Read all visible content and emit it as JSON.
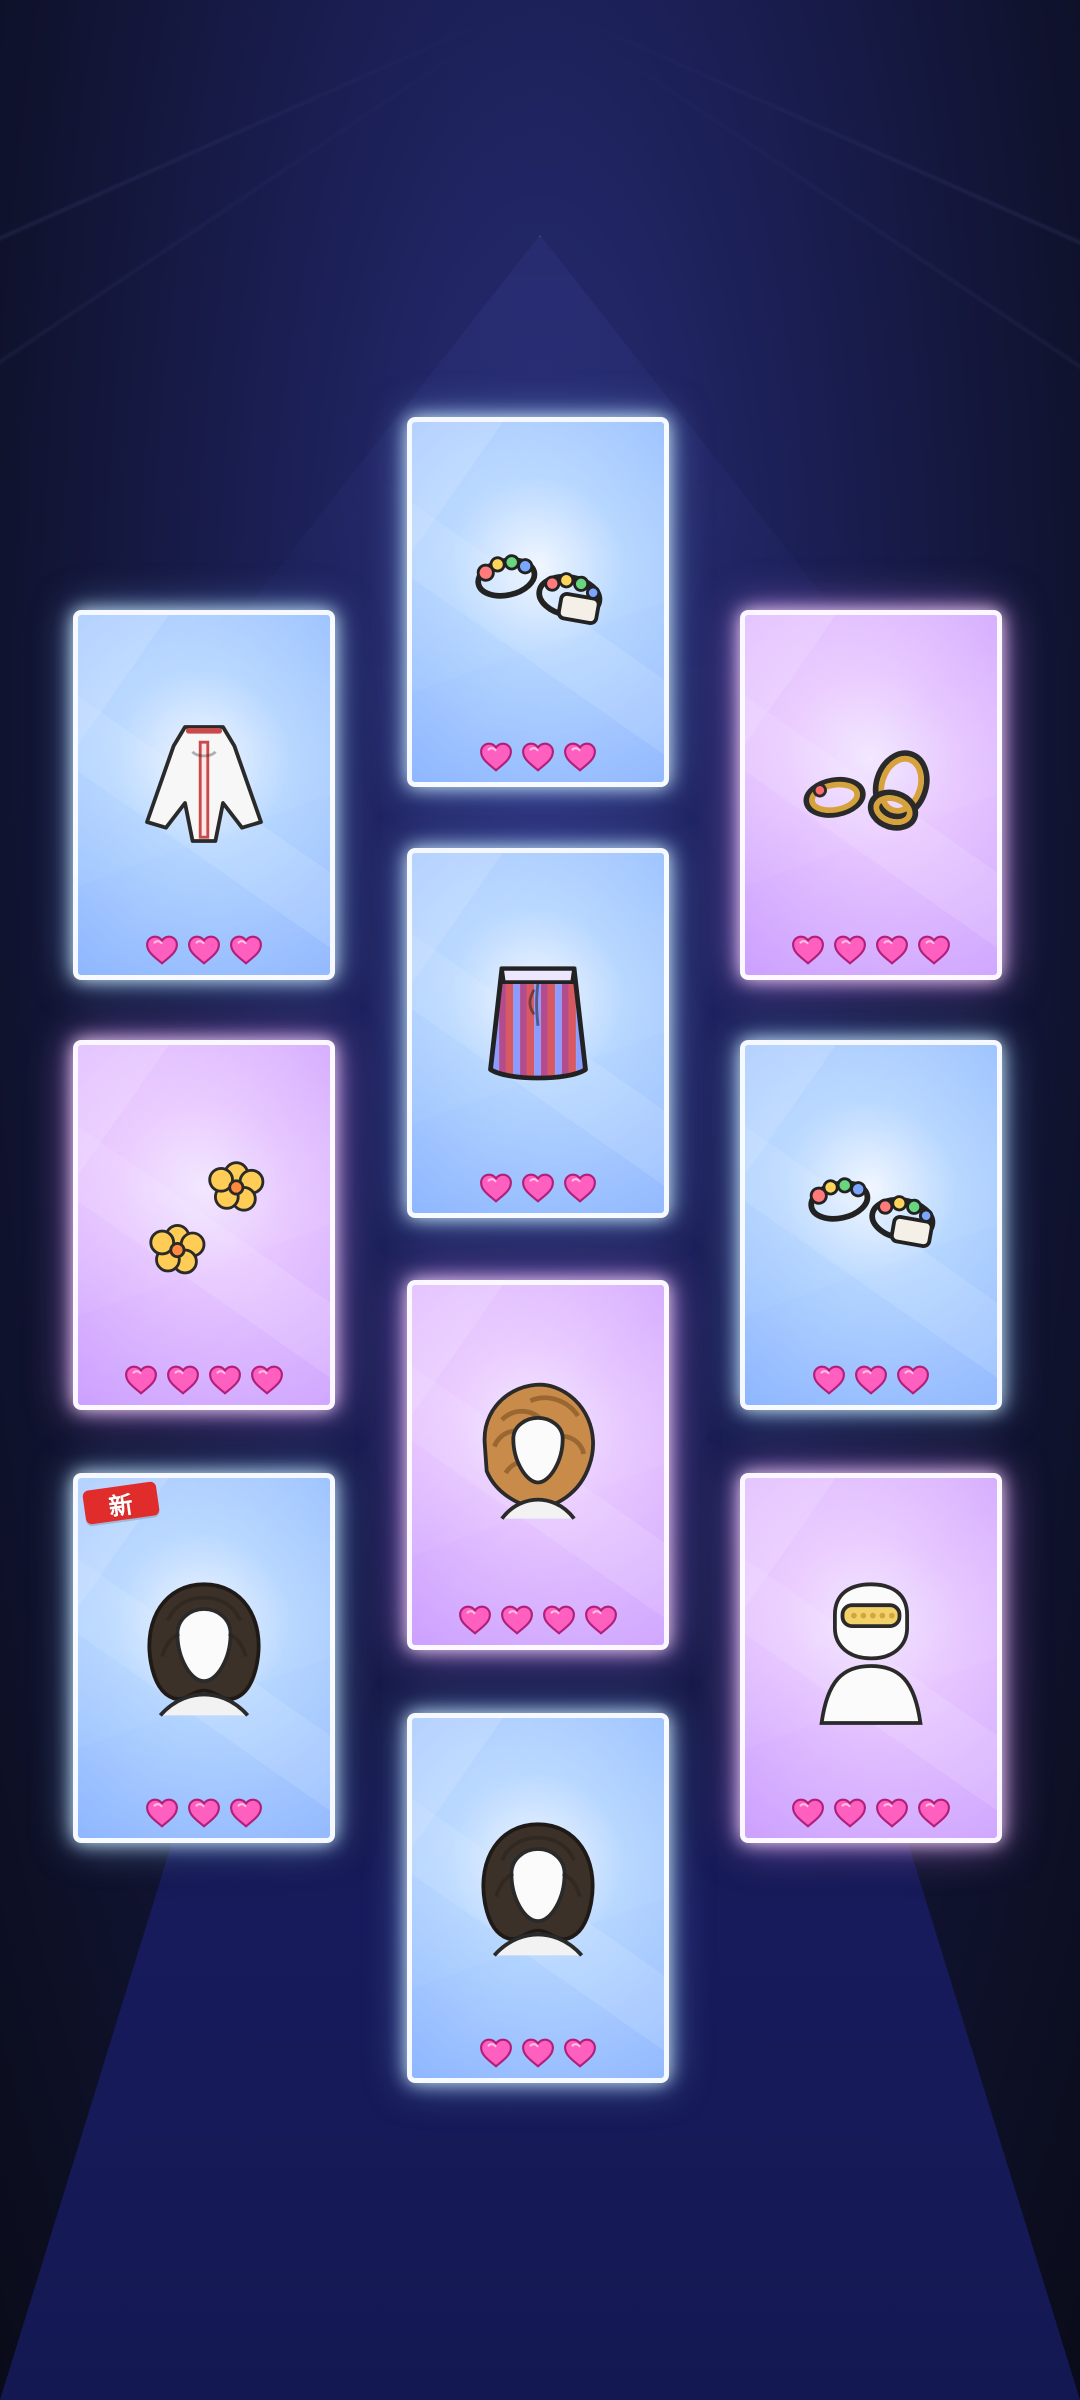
{
  "screen": {
    "type": "gacha-results"
  },
  "cards": [
    {
      "id": "top-center",
      "variant": "blue",
      "item": "bracelets",
      "hearts": 3,
      "is_new": false
    },
    {
      "id": "left-1",
      "variant": "blue",
      "item": "cape",
      "hearts": 3,
      "is_new": false
    },
    {
      "id": "right-1",
      "variant": "purple",
      "item": "gold-bangles",
      "hearts": 4,
      "is_new": false
    },
    {
      "id": "center-2",
      "variant": "blue",
      "item": "striped-skirt",
      "hearts": 3,
      "is_new": false
    },
    {
      "id": "left-2",
      "variant": "purple",
      "item": "flower-earrings",
      "hearts": 4,
      "is_new": false
    },
    {
      "id": "right-2",
      "variant": "blue",
      "item": "bracelets",
      "hearts": 3,
      "is_new": false
    },
    {
      "id": "center-3",
      "variant": "purple",
      "item": "curly-updo-hair",
      "hearts": 4,
      "is_new": false
    },
    {
      "id": "left-3",
      "variant": "blue",
      "item": "bob-hair",
      "hearts": 3,
      "is_new": true,
      "new_label": "新"
    },
    {
      "id": "right-3",
      "variant": "purple",
      "item": "choker-necklace",
      "hearts": 4,
      "is_new": false
    },
    {
      "id": "bottom-center",
      "variant": "blue",
      "item": "bob-hair",
      "hearts": 3,
      "is_new": false
    }
  ],
  "colors": {
    "heart_fill": "#ff5fbf",
    "heart_stroke": "#b01f7a",
    "new_badge": "#e12c2c"
  }
}
